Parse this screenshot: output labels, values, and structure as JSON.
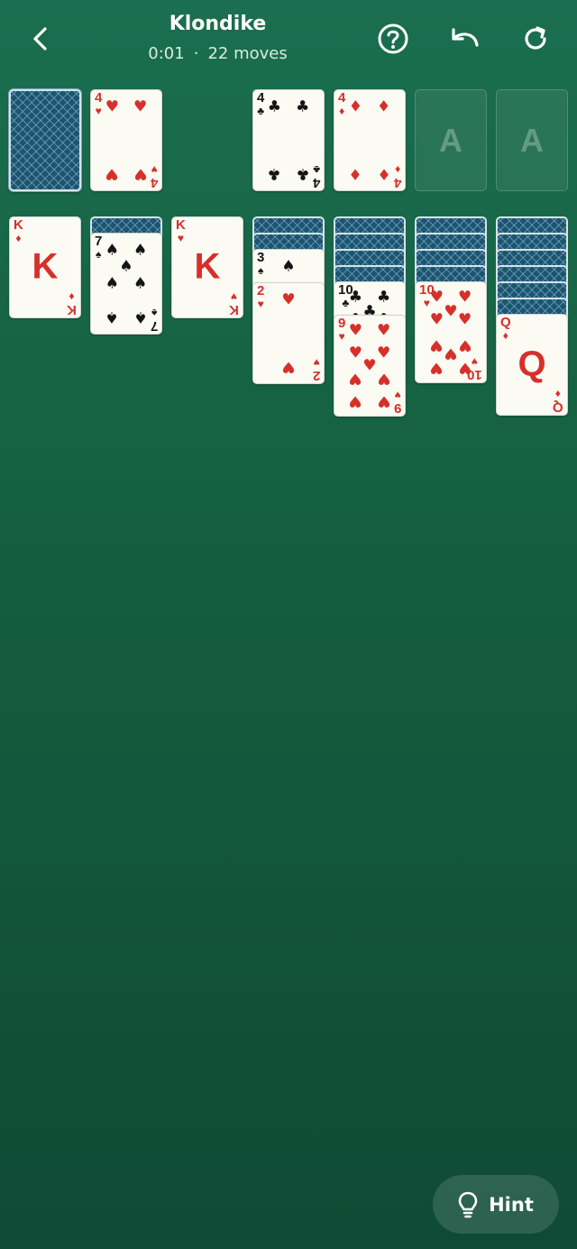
{
  "header": {
    "title": "Klondike",
    "time": "0:01",
    "separator": "·",
    "moves": "22 moves"
  },
  "foundations": [
    {
      "empty": false,
      "rank": "4",
      "suit": "♣",
      "color": "black"
    },
    {
      "empty": false,
      "rank": "4",
      "suit": "♦",
      "color": "red"
    },
    {
      "empty": true,
      "label": "A"
    },
    {
      "empty": true,
      "label": "A"
    }
  ],
  "waste": {
    "rank": "4",
    "suit": "♥",
    "color": "red"
  },
  "tableau": [
    {
      "face_down": 0,
      "face_up": [
        {
          "rank": "K",
          "suit": "♦",
          "color": "red"
        }
      ]
    },
    {
      "face_down": 1,
      "face_up": [
        {
          "rank": "7",
          "suit": "♠",
          "color": "black"
        }
      ]
    },
    {
      "face_down": 0,
      "face_up": [
        {
          "rank": "K",
          "suit": "♥",
          "color": "red"
        }
      ]
    },
    {
      "face_down": 2,
      "face_up": [
        {
          "rank": "3",
          "suit": "♠",
          "color": "black"
        },
        {
          "rank": "2",
          "suit": "♥",
          "color": "red"
        }
      ]
    },
    {
      "face_down": 4,
      "face_up": [
        {
          "rank": "10",
          "suit": "♣",
          "color": "black"
        },
        {
          "rank": "9",
          "suit": "♥",
          "color": "red"
        }
      ]
    },
    {
      "face_down": 4,
      "face_up": [
        {
          "rank": "10",
          "suit": "♥",
          "color": "red"
        }
      ]
    },
    {
      "face_down": 6,
      "face_up": [
        {
          "rank": "Q",
          "suit": "♦",
          "color": "red"
        }
      ]
    }
  ],
  "hint": {
    "label": "Hint"
  },
  "colors": {
    "felt": "#176347",
    "red_suit": "#d6302a",
    "black_suit": "#141414",
    "card_back": "#1d5570"
  }
}
